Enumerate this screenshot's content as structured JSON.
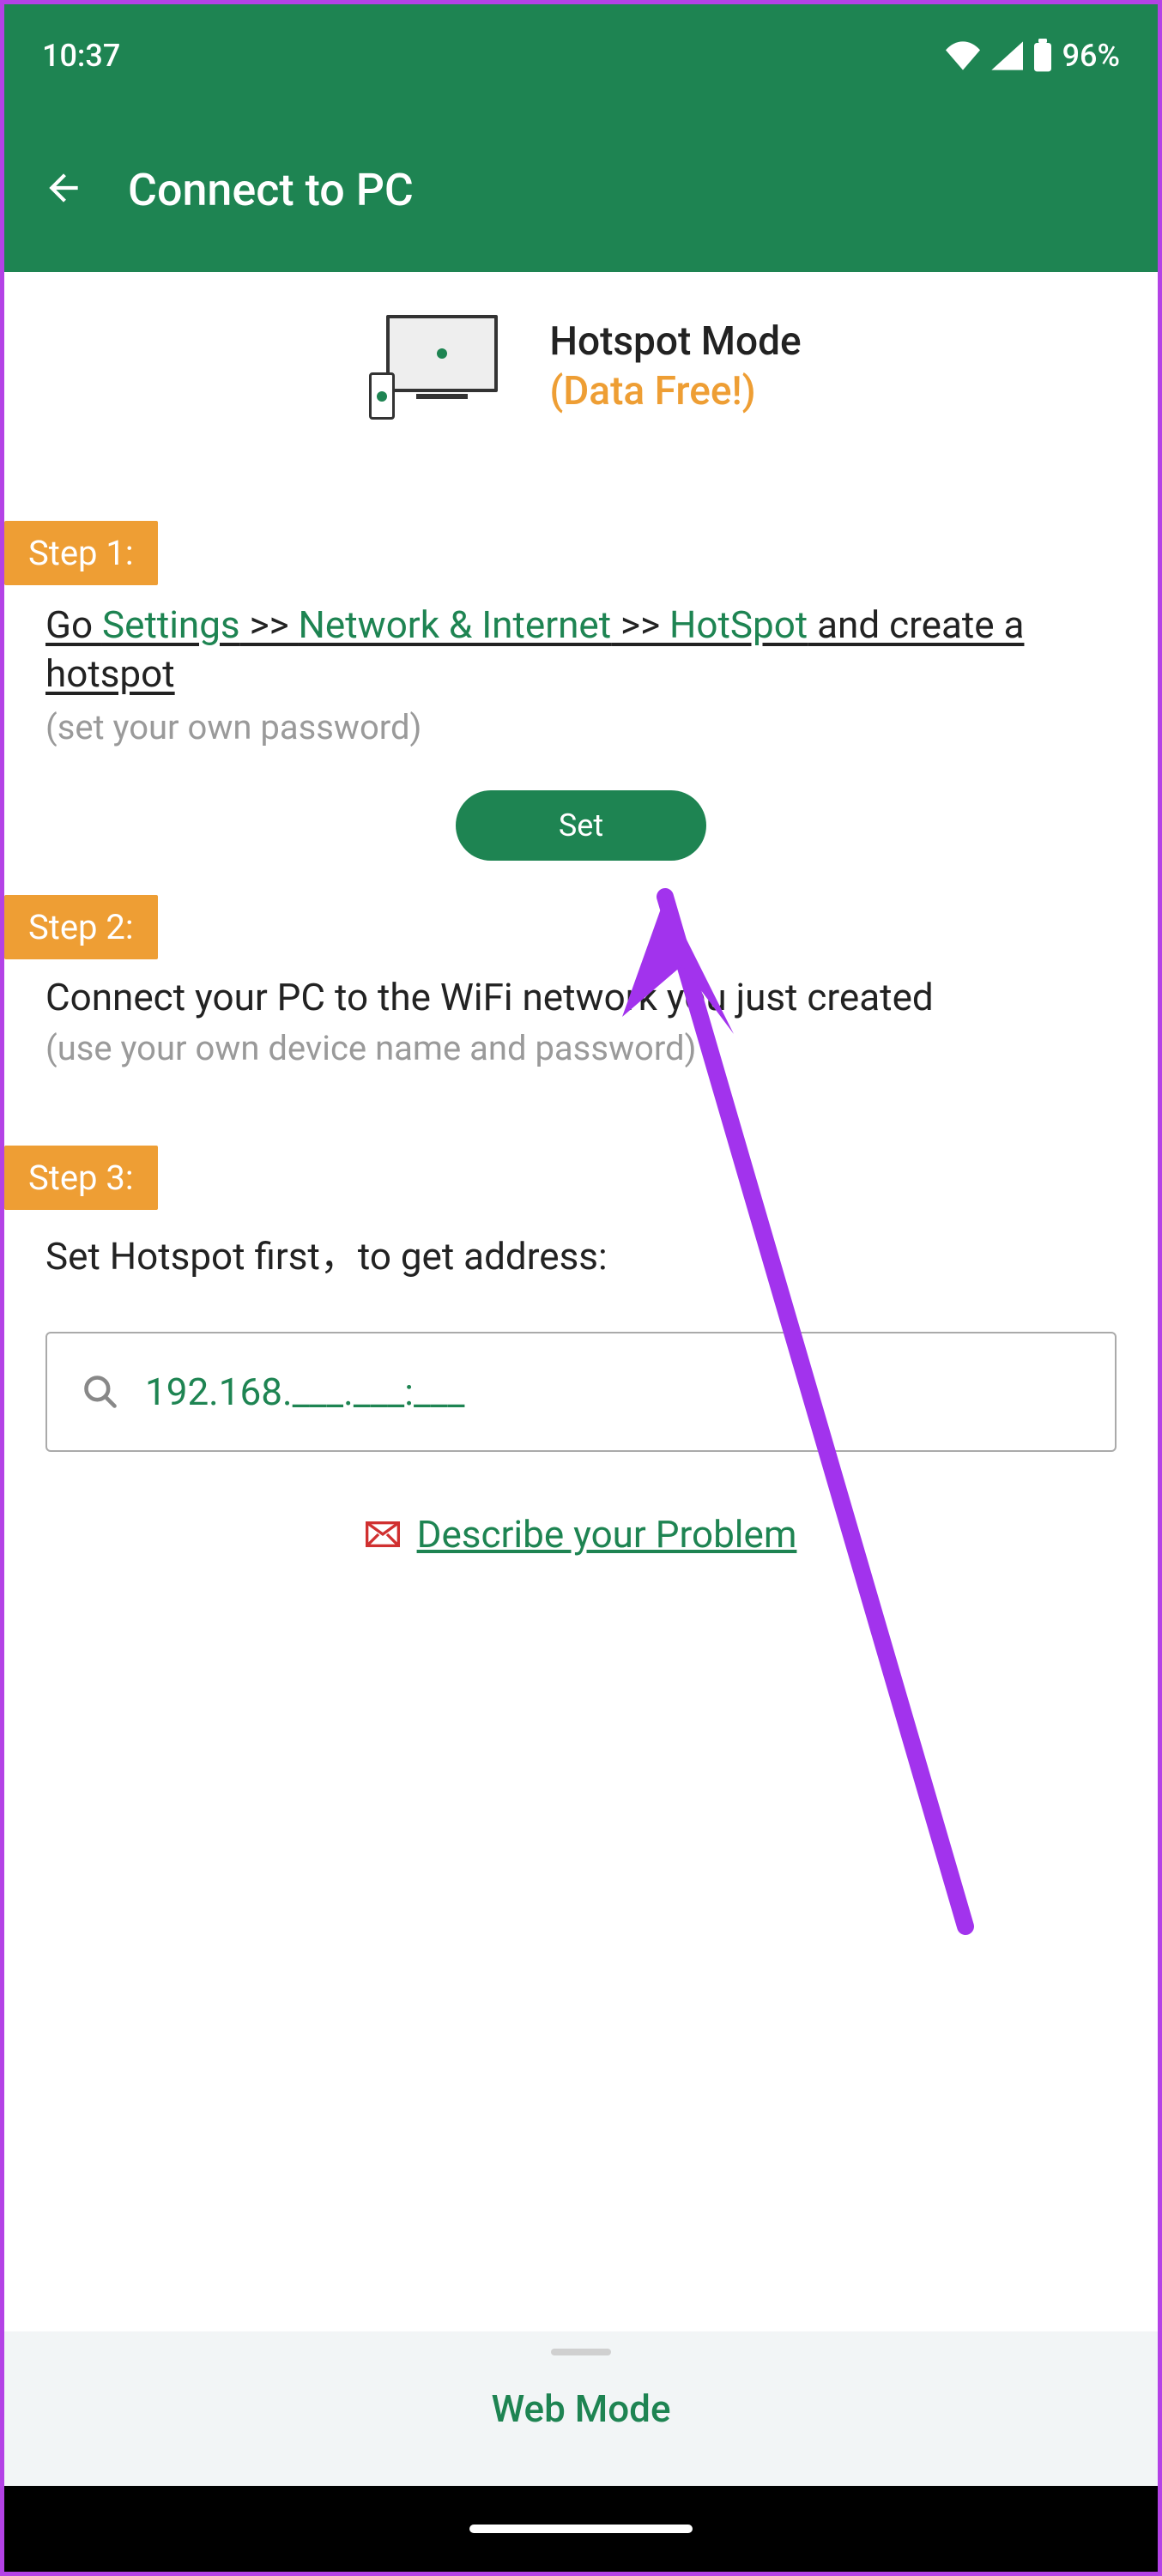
{
  "statusbar": {
    "time": "10:37",
    "battery": "96%"
  },
  "appbar": {
    "title": "Connect to PC"
  },
  "mode": {
    "title": "Hotspot Mode",
    "subtitle": "(Data Free!)"
  },
  "steps": {
    "s1": {
      "badge": "Step 1:",
      "text_go": "Go ",
      "text_settings": "Settings",
      "text_sep": " >> ",
      "text_network": "Network & Internet",
      "text_hotspot": "HotSpot",
      "text_rest": " and create a hotspot",
      "hint": "(set your own password)",
      "button": "Set"
    },
    "s2": {
      "badge": "Step 2:",
      "text": "Connect your PC to the WiFi network you just created",
      "hint": "(use your own device name and password)"
    },
    "s3": {
      "badge": "Step 3:",
      "text": "Set Hotspot first，to get address:"
    }
  },
  "address": {
    "value": "192.168.___.___:___"
  },
  "problem": {
    "label": "Describe your Problem"
  },
  "footer": {
    "label": "Web Mode"
  },
  "colors": {
    "primary": "#1e8452",
    "accent": "#ee9e34",
    "annotation": "#a233ed"
  }
}
